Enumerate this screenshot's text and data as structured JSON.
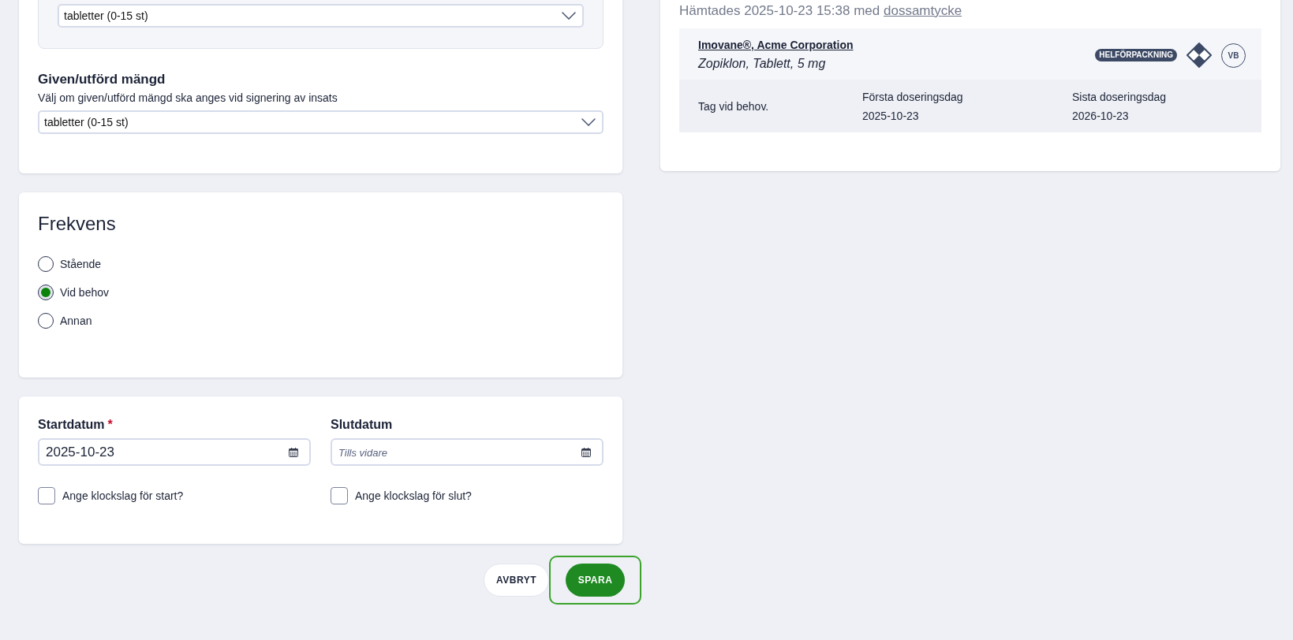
{
  "dosage_panel": {
    "select": {
      "value": "tabletter (0-15 st)"
    }
  },
  "given_amount": {
    "title": "Given/utförd mängd",
    "description": "Välj om given/utförd mängd ska anges vid signering av insats",
    "select": {
      "value": "tabletter (0-15 st)"
    }
  },
  "frequency": {
    "title": "Frekvens",
    "options": [
      {
        "label": "Stående",
        "selected": false
      },
      {
        "label": "Vid behov",
        "selected": true
      },
      {
        "label": "Annan",
        "selected": false
      }
    ]
  },
  "dates": {
    "fields": [
      {
        "label": "Startdatum",
        "required_mark": "*",
        "value": "2025-10-23",
        "checkbox": {
          "label": "Ange klockslag för start?",
          "checked": false
        }
      },
      {
        "label": "Slutdatum",
        "placeholder": "Tills vidare",
        "checkbox": {
          "label": "Ange klockslag för slut?",
          "checked": false
        }
      }
    ]
  },
  "actions": [
    {
      "label": "AVBRYT",
      "kind": "secondary",
      "focused": false
    },
    {
      "label": "SPARA",
      "kind": "primary",
      "focused": true
    }
  ],
  "prescription": {
    "fetched_text": "Hämtades 2025-10-23 15:38 med",
    "fetched_link": "dossamtycke",
    "medication": {
      "name": "Imovane®, Acme Corporation",
      "description": "Zopiklon, Tablett, 5 mg",
      "package_badge": "HELFÖRPACKNING",
      "vb_badge": "VB"
    },
    "instruction": "Tag vid behov.",
    "first_day": {
      "label": "Första doseringsdag",
      "value": "2025-10-23"
    },
    "last_day": {
      "label": "Sista doseringsdag",
      "value": "2026-10-23"
    }
  }
}
